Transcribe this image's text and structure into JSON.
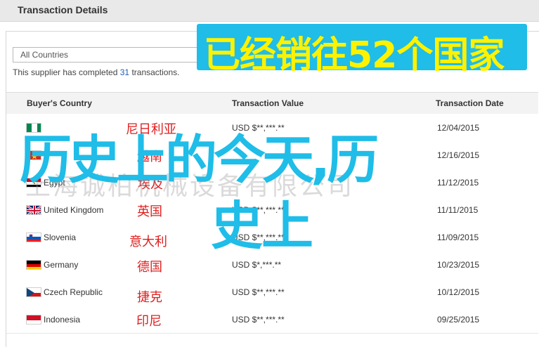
{
  "header": {
    "title": "Transaction Details"
  },
  "filter": {
    "selected": "All Countries"
  },
  "summary": {
    "prefix": "This supplier has completed ",
    "count": "31",
    "suffix": " transactions."
  },
  "table": {
    "columns": [
      "Buyer's Country",
      "Transaction Value",
      "Transaction Date"
    ],
    "rows": [
      {
        "flag": "nigeria",
        "country": "",
        "value": "USD $**,***.**",
        "date": "12/04/2015",
        "overlay": "尼日利亚"
      },
      {
        "flag": "vietnam",
        "country": "",
        "value": "",
        "date": "12/16/2015",
        "overlay": "越南"
      },
      {
        "flag": "egypt",
        "country": "Egypt",
        "value": "",
        "date": "11/12/2015",
        "overlay": "埃及"
      },
      {
        "flag": "uk",
        "country": "United Kingdom",
        "value": "USD $**,***.**",
        "date": "11/11/2015",
        "overlay": "英国"
      },
      {
        "flag": "slovenia",
        "country": "Slovenia",
        "value": "USD $**,***.**",
        "date": "11/09/2015",
        "overlay": "意大利"
      },
      {
        "flag": "germany",
        "country": "Germany",
        "value": "USD $*,***.**",
        "date": "10/23/2015",
        "overlay": "德国"
      },
      {
        "flag": "czech",
        "country": "Czech Republic",
        "value": "USD $**,***.**",
        "date": "10/12/2015",
        "overlay": "捷克"
      },
      {
        "flag": "indonesia",
        "country": "Indonesia",
        "value": "USD $**,***.**",
        "date": "09/25/2015",
        "overlay": "印尼"
      }
    ]
  },
  "overlays": {
    "banner": "已经销往52个国家",
    "big_line1": "历史上的今天,历",
    "big_line2": "史上",
    "watermark": "上海诚柏机械设备有限公司"
  },
  "colors": {
    "banner_bg": "#1fbde8",
    "banner_text": "#fff200",
    "big_text": "#1fbde8",
    "overlay_red": "#e02020"
  }
}
